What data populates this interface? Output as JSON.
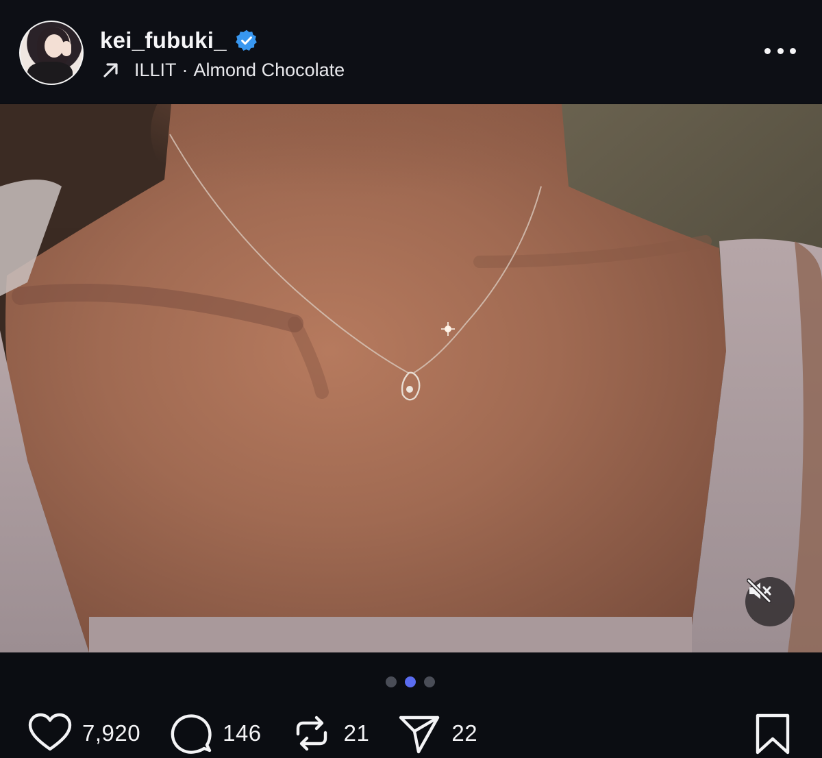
{
  "post": {
    "author": {
      "username": "kei_fubuki_",
      "verified": true,
      "avatar_icon": "profile-avatar"
    },
    "music": {
      "artist": "ILLIT",
      "separator": "·",
      "track": "Almond Chocolate"
    },
    "media": {
      "carousel_total": 3,
      "carousel_active_index": 1,
      "audio_muted": true
    },
    "actions": {
      "likes": "7,920",
      "comments": "146",
      "reposts": "21",
      "shares": "22"
    }
  },
  "colors": {
    "background": "#0b0d12",
    "text": "#f2f2f4",
    "verified_badge": "#3897f0",
    "carousel_active": "#5a6cf0",
    "carousel_inactive": "#4a4d57"
  },
  "icons": {
    "verified": "verified-badge-icon",
    "music": "arrow-up-right-icon",
    "more": "more-options-icon",
    "mute": "speaker-muted-icon",
    "like": "heart-icon",
    "comment": "comment-bubble-icon",
    "repost": "repost-icon",
    "share": "paper-plane-icon",
    "save": "bookmark-icon"
  }
}
